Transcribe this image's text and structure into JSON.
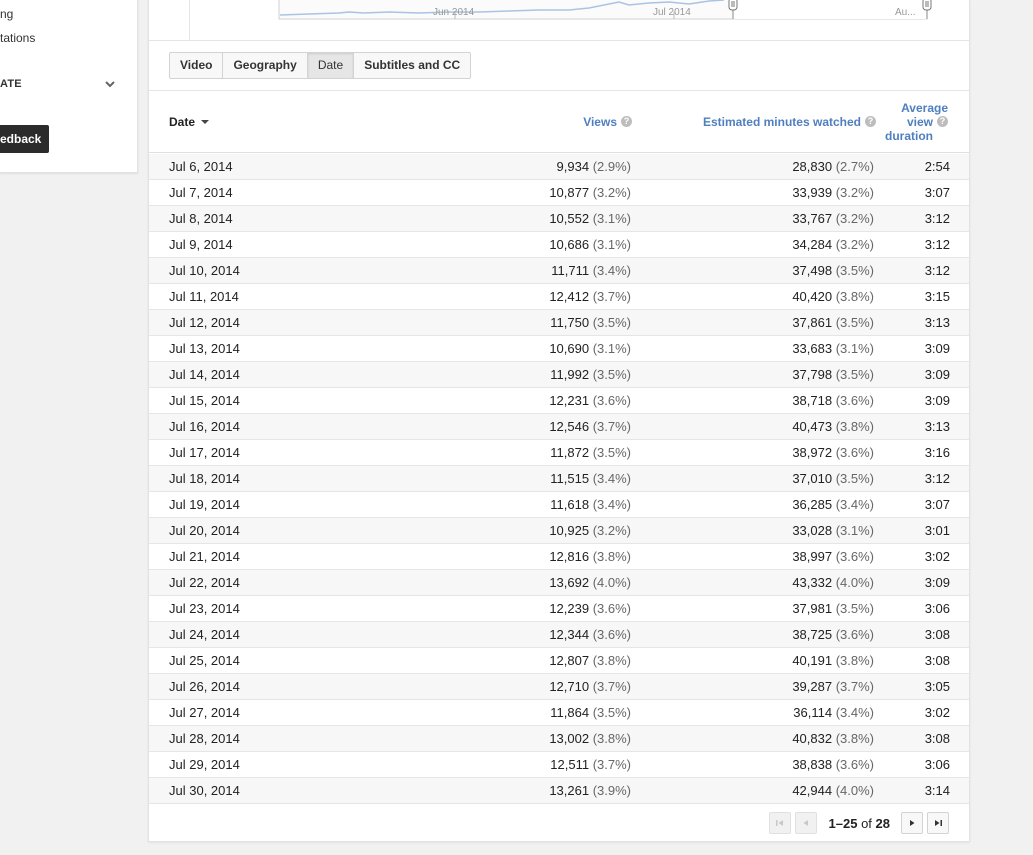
{
  "sidebar": {
    "item1": "ng",
    "item2": "tations",
    "section_label": "ATE",
    "feedback_label": "edback"
  },
  "chart": {
    "tick_labels": [
      "Jun 2014",
      "Jul 2014",
      "Au..."
    ],
    "line_color": "#a9c4e2"
  },
  "tabs": [
    {
      "label": "Video",
      "active": false
    },
    {
      "label": "Geography",
      "active": false
    },
    {
      "label": "Date",
      "active": true
    },
    {
      "label": "Subtitles and CC",
      "active": false
    }
  ],
  "table": {
    "headers": {
      "date": "Date",
      "views": "Views",
      "minutes": "Estimated minutes watched",
      "avg_line1": "Average",
      "avg_line2": "view",
      "avg_line3": "duration"
    },
    "rows": [
      {
        "date": "Jul 6, 2014",
        "views": "9,934",
        "views_pct": "(2.9%)",
        "minutes": "28,830",
        "minutes_pct": "(2.7%)",
        "avg": "2:54"
      },
      {
        "date": "Jul 7, 2014",
        "views": "10,877",
        "views_pct": "(3.2%)",
        "minutes": "33,939",
        "minutes_pct": "(3.2%)",
        "avg": "3:07"
      },
      {
        "date": "Jul 8, 2014",
        "views": "10,552",
        "views_pct": "(3.1%)",
        "minutes": "33,767",
        "minutes_pct": "(3.2%)",
        "avg": "3:12"
      },
      {
        "date": "Jul 9, 2014",
        "views": "10,686",
        "views_pct": "(3.1%)",
        "minutes": "34,284",
        "minutes_pct": "(3.2%)",
        "avg": "3:12"
      },
      {
        "date": "Jul 10, 2014",
        "views": "11,711",
        "views_pct": "(3.4%)",
        "minutes": "37,498",
        "minutes_pct": "(3.5%)",
        "avg": "3:12"
      },
      {
        "date": "Jul 11, 2014",
        "views": "12,412",
        "views_pct": "(3.7%)",
        "minutes": "40,420",
        "minutes_pct": "(3.8%)",
        "avg": "3:15"
      },
      {
        "date": "Jul 12, 2014",
        "views": "11,750",
        "views_pct": "(3.5%)",
        "minutes": "37,861",
        "minutes_pct": "(3.5%)",
        "avg": "3:13"
      },
      {
        "date": "Jul 13, 2014",
        "views": "10,690",
        "views_pct": "(3.1%)",
        "minutes": "33,683",
        "minutes_pct": "(3.1%)",
        "avg": "3:09"
      },
      {
        "date": "Jul 14, 2014",
        "views": "11,992",
        "views_pct": "(3.5%)",
        "minutes": "37,798",
        "minutes_pct": "(3.5%)",
        "avg": "3:09"
      },
      {
        "date": "Jul 15, 2014",
        "views": "12,231",
        "views_pct": "(3.6%)",
        "minutes": "38,718",
        "minutes_pct": "(3.6%)",
        "avg": "3:09"
      },
      {
        "date": "Jul 16, 2014",
        "views": "12,546",
        "views_pct": "(3.7%)",
        "minutes": "40,473",
        "minutes_pct": "(3.8%)",
        "avg": "3:13"
      },
      {
        "date": "Jul 17, 2014",
        "views": "11,872",
        "views_pct": "(3.5%)",
        "minutes": "38,972",
        "minutes_pct": "(3.6%)",
        "avg": "3:16"
      },
      {
        "date": "Jul 18, 2014",
        "views": "11,515",
        "views_pct": "(3.4%)",
        "minutes": "37,010",
        "minutes_pct": "(3.5%)",
        "avg": "3:12"
      },
      {
        "date": "Jul 19, 2014",
        "views": "11,618",
        "views_pct": "(3.4%)",
        "minutes": "36,285",
        "minutes_pct": "(3.4%)",
        "avg": "3:07"
      },
      {
        "date": "Jul 20, 2014",
        "views": "10,925",
        "views_pct": "(3.2%)",
        "minutes": "33,028",
        "minutes_pct": "(3.1%)",
        "avg": "3:01"
      },
      {
        "date": "Jul 21, 2014",
        "views": "12,816",
        "views_pct": "(3.8%)",
        "minutes": "38,997",
        "minutes_pct": "(3.6%)",
        "avg": "3:02"
      },
      {
        "date": "Jul 22, 2014",
        "views": "13,692",
        "views_pct": "(4.0%)",
        "minutes": "43,332",
        "minutes_pct": "(4.0%)",
        "avg": "3:09"
      },
      {
        "date": "Jul 23, 2014",
        "views": "12,239",
        "views_pct": "(3.6%)",
        "minutes": "37,981",
        "minutes_pct": "(3.5%)",
        "avg": "3:06"
      },
      {
        "date": "Jul 24, 2014",
        "views": "12,344",
        "views_pct": "(3.6%)",
        "minutes": "38,725",
        "minutes_pct": "(3.6%)",
        "avg": "3:08"
      },
      {
        "date": "Jul 25, 2014",
        "views": "12,807",
        "views_pct": "(3.8%)",
        "minutes": "40,191",
        "minutes_pct": "(3.8%)",
        "avg": "3:08"
      },
      {
        "date": "Jul 26, 2014",
        "views": "12,710",
        "views_pct": "(3.7%)",
        "minutes": "39,287",
        "minutes_pct": "(3.7%)",
        "avg": "3:05"
      },
      {
        "date": "Jul 27, 2014",
        "views": "11,864",
        "views_pct": "(3.5%)",
        "minutes": "36,114",
        "minutes_pct": "(3.4%)",
        "avg": "3:02"
      },
      {
        "date": "Jul 28, 2014",
        "views": "13,002",
        "views_pct": "(3.8%)",
        "minutes": "40,832",
        "minutes_pct": "(3.8%)",
        "avg": "3:08"
      },
      {
        "date": "Jul 29, 2014",
        "views": "12,511",
        "views_pct": "(3.7%)",
        "minutes": "38,838",
        "minutes_pct": "(3.6%)",
        "avg": "3:06"
      },
      {
        "date": "Jul 30, 2014",
        "views": "13,261",
        "views_pct": "(3.9%)",
        "minutes": "42,944",
        "minutes_pct": "(4.0%)",
        "avg": "3:14"
      }
    ]
  },
  "pagination": {
    "range": "1–25",
    "of_label": "of",
    "total": "28"
  },
  "colors": {
    "link": "#4f7fbf",
    "feedback_bg": "#2b2b2b"
  }
}
